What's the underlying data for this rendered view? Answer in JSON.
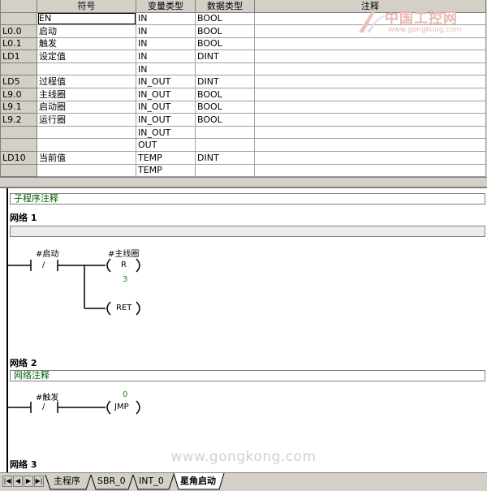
{
  "var_table": {
    "headers": [
      "",
      "符号",
      "变量类型",
      "数据类型",
      "注释"
    ],
    "rows": [
      {
        "addr": "",
        "symbol": "EN",
        "var_type": "IN",
        "data_type": "BOOL",
        "comment": ""
      },
      {
        "addr": "L0.0",
        "symbol": "启动",
        "var_type": "IN",
        "data_type": "BOOL",
        "comment": ""
      },
      {
        "addr": "L0.1",
        "symbol": "触发",
        "var_type": "IN",
        "data_type": "BOOL",
        "comment": ""
      },
      {
        "addr": "LD1",
        "symbol": "设定值",
        "var_type": "IN",
        "data_type": "DINT",
        "comment": ""
      },
      {
        "addr": "",
        "symbol": "",
        "var_type": "IN",
        "data_type": "",
        "comment": ""
      },
      {
        "addr": "LD5",
        "symbol": "过程值",
        "var_type": "IN_OUT",
        "data_type": "DINT",
        "comment": ""
      },
      {
        "addr": "L9.0",
        "symbol": "主线圈",
        "var_type": "IN_OUT",
        "data_type": "BOOL",
        "comment": ""
      },
      {
        "addr": "L9.1",
        "symbol": "启动圈",
        "var_type": "IN_OUT",
        "data_type": "BOOL",
        "comment": ""
      },
      {
        "addr": "L9.2",
        "symbol": "运行圈",
        "var_type": "IN_OUT",
        "data_type": "BOOL",
        "comment": ""
      },
      {
        "addr": "",
        "symbol": "",
        "var_type": "IN_OUT",
        "data_type": "",
        "comment": ""
      },
      {
        "addr": "",
        "symbol": "",
        "var_type": "OUT",
        "data_type": "",
        "comment": ""
      },
      {
        "addr": "LD10",
        "symbol": "当前值",
        "var_type": "TEMP",
        "data_type": "DINT",
        "comment": ""
      },
      {
        "addr": "",
        "symbol": "",
        "var_type": "TEMP",
        "data_type": "",
        "comment": ""
      }
    ]
  },
  "logo": {
    "title": "中国工控网",
    "url": "www.gongkong.com"
  },
  "editor": {
    "subroutine_comment": "子程序注释",
    "network1": {
      "title": "网络 1",
      "contact_label": "#启动",
      "contact_symbol": "/",
      "coil_label": "#主线圈",
      "coil_symbol": "R",
      "coil_count": "3",
      "ret_label": "RET"
    },
    "network2": {
      "title": "网络 2",
      "comment": "网络注释",
      "contact_label": "#触发",
      "contact_symbol": "/",
      "jmp_number": "0",
      "jmp_label": "JMP"
    },
    "network3": {
      "title": "网络 3"
    }
  },
  "watermark": "www.gongkong.com",
  "tabs": {
    "nav": [
      "|◀",
      "◀",
      "▶",
      "▶|"
    ],
    "items": [
      "主程序",
      "SBR_0",
      "INT_0",
      "星角启动"
    ],
    "active_index": 3
  }
}
